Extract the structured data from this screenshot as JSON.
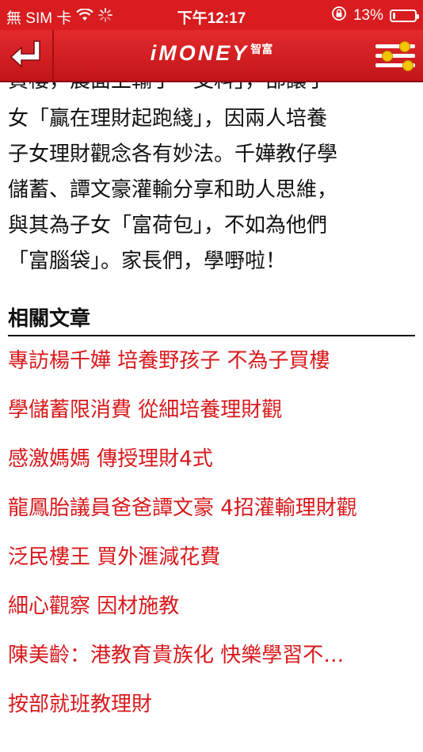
{
  "status_bar": {
    "carrier": "無 SIM 卡",
    "time": "下午12:17",
    "battery": "13%",
    "battery_level": 0.13
  },
  "nav": {
    "logo_main": "iMONEY",
    "logo_sub": "智富"
  },
  "article": {
    "lines": [
      "女「贏在理財起跑綫」，因兩人培養",
      "子女理財觀念各有妙法。千嬅教仔學",
      "儲蓄、譚文豪灌輸分享和助人思維，",
      "與其為子女「富荷包」，不如為他們",
      "「富腦袋」。家長們，學嘢啦！"
    ],
    "partial_line": "買樓，農面上輸了一支料」，部讓子"
  },
  "related": {
    "title": "相關文章",
    "items": [
      "專訪楊千嬅 培養野孩子 不為子買樓",
      "學儲蓄限消費 從細培養理財觀",
      "感激媽媽 傳授理財4式",
      "龍鳳胎議員爸爸譚文豪 4招灌輸理財觀",
      "泛民樓王 買外滙減花費",
      "細心觀察 因材施教",
      "陳美齡：港教育貴族化 快樂學習不…",
      "按部就班教理財"
    ]
  },
  "colors": {
    "brand_red": "#d81c1f",
    "link_red": "#d8191c",
    "knob_yellow": "#f5c400"
  }
}
